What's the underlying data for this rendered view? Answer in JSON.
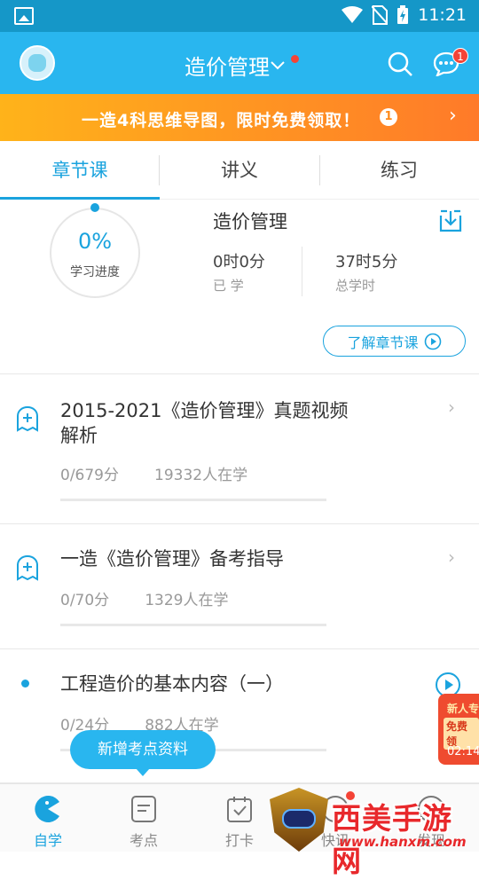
{
  "status_bar": {
    "time": "11:21"
  },
  "header": {
    "title": "造价管理",
    "message_badge": "1"
  },
  "banner": {
    "text": "一造4科思维导图，限时免费领取！",
    "badge": "1"
  },
  "tabs": [
    {
      "label": "章节课",
      "active": true
    },
    {
      "label": "讲义",
      "active": false
    },
    {
      "label": "练习",
      "active": false
    }
  ],
  "progress": {
    "percent": "0%",
    "percent_label": "学习进度",
    "course_title": "造价管理",
    "learned_value": "0时0分",
    "learned_label": "已 学",
    "total_value": "37时5分",
    "total_label": "总学时",
    "learn_button": "了解章节课"
  },
  "items": [
    {
      "title": "2015-2021《造价管理》真题视频解析",
      "score": "0/679分",
      "learners": "19332人在学"
    },
    {
      "title": "一造《造价管理》备考指导",
      "score": "0/70分",
      "learners": "1329人在学"
    },
    {
      "title": "工程造价的基本内容（一）",
      "score": "0/24分",
      "learners": "882人在学"
    }
  ],
  "floating_tip": "新增考点资料",
  "promo": {
    "line1": "新人专",
    "line2": "免费领",
    "timer": "02:14"
  },
  "bottom_nav": [
    {
      "label": "自学",
      "icon": "pacman-icon",
      "active": true
    },
    {
      "label": "考点",
      "icon": "document-icon",
      "active": false
    },
    {
      "label": "打卡",
      "icon": "calendar-check-icon",
      "active": false
    },
    {
      "label": "快讯",
      "icon": "news-icon",
      "active": false
    },
    {
      "label": "发现",
      "icon": "compass-icon",
      "active": false
    }
  ],
  "watermark": {
    "title": "西美手游网",
    "url": "www.hanxm.com"
  },
  "colors": {
    "primary": "#29b6ef",
    "accent": "#1aa3de",
    "banner_start": "#ffb31a",
    "banner_end": "#ff7a29",
    "badge_red": "#f44336"
  }
}
